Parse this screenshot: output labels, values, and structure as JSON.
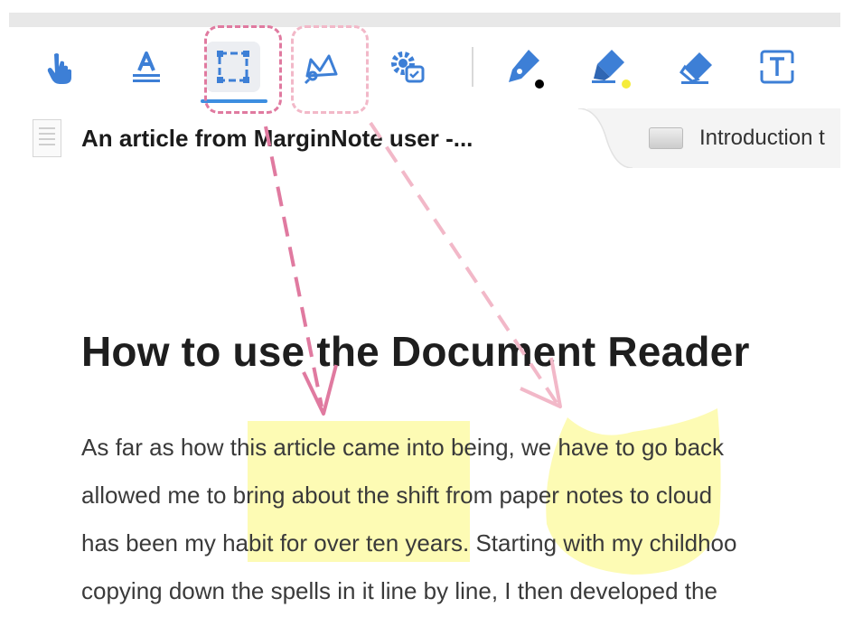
{
  "toolbar": {
    "tools": [
      {
        "name": "hand-tool",
        "icon": "hand-pointer-icon"
      },
      {
        "name": "text-select-tool",
        "icon": "text-underline-A-icon"
      },
      {
        "name": "rectangle-select-tool",
        "icon": "dashed-rectangle-icon",
        "active": true
      },
      {
        "name": "lasso-select-tool",
        "icon": "lasso-crown-icon"
      },
      {
        "name": "settings-tool",
        "icon": "gear-badge-icon"
      },
      {
        "name": "pen-tool",
        "icon": "fountain-pen-icon",
        "dot_color": "#000000"
      },
      {
        "name": "highlighter-tool",
        "icon": "highlighter-icon",
        "dot_color": "#f5ec3a"
      },
      {
        "name": "eraser-tool",
        "icon": "eraser-icon"
      },
      {
        "name": "text-box-tool",
        "icon": "text-box-T-icon"
      }
    ],
    "accent": "#3d8ee0"
  },
  "tabs": [
    {
      "title": "An article from MarginNote user -...",
      "active": true
    },
    {
      "title": "Introduction t",
      "active": false
    }
  ],
  "document": {
    "heading": "How to use the Document Reader",
    "lines": [
      "As far as how this article came into being, we have to go back",
      "allowed me to bring about the shift from paper notes to cloud",
      "has been my habit for over ten years. Starting with my childhoo",
      "copying down the spells in it line by line, I then developed the"
    ]
  },
  "colors": {
    "highlight": "#fdfbb4",
    "annotation_pink": "#e07aa0",
    "annotation_light_pink": "#f2b8c8"
  }
}
